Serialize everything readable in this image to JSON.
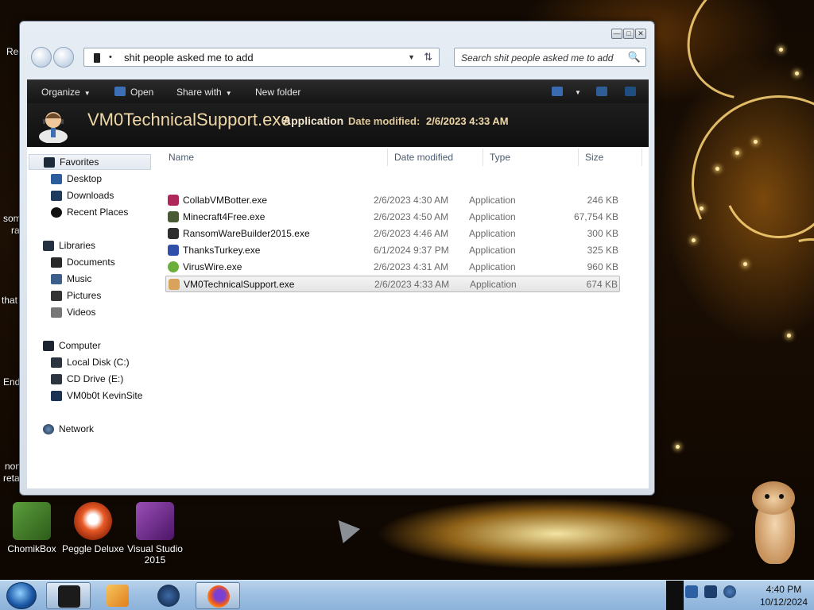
{
  "desktop": {
    "left_fragments": [
      "Rec",
      "som",
      "ra",
      "that",
      "End",
      "non",
      "reta"
    ],
    "icons": [
      {
        "label": "ChomikBox",
        "icon": "chomikbox-icon",
        "color": "#3f7d2a"
      },
      {
        "label": "Peggle Deluxe",
        "icon": "peggle-icon",
        "color": "#c43c16"
      },
      {
        "label": "Visual Studio 2015",
        "icon": "visual-studio-icon",
        "color": "#68217a"
      }
    ]
  },
  "window": {
    "caption_buttons": [
      "—",
      "□",
      "✕"
    ],
    "address": {
      "separator": "•",
      "path": "shit people asked me to add",
      "dropdown": "▼",
      "refresh": "⇅"
    },
    "search": {
      "placeholder": "Search shit people asked me to add",
      "icon": "🔍"
    },
    "toolbar": {
      "organize": "Organize",
      "open": "Open",
      "share_with": "Share with",
      "new_folder": "New folder",
      "arrow": "▼"
    },
    "details": {
      "filename": "VM0TechnicalSupport.exe",
      "type": "Application",
      "date_label": "Date modified:",
      "date_value": "2/6/2023 4:33 AM"
    },
    "nav": {
      "favorites": "Favorites",
      "favorite_items": [
        "Desktop",
        "Downloads",
        "Recent Places"
      ],
      "libraries": "Libraries",
      "library_items": [
        "Documents",
        "Music",
        "Pictures",
        "Videos"
      ],
      "computer": "Computer",
      "computer_items": [
        "Local Disk (C:)",
        "CD Drive (E:)",
        "VM0b0t KevinSite"
      ],
      "network": "Network"
    },
    "columns": {
      "name": "Name",
      "date": "Date modified",
      "type": "Type",
      "size": "Size"
    },
    "files": [
      {
        "name": "CollabVMBotter.exe",
        "date": "2/6/2023 4:30 AM",
        "type": "Application",
        "size": "246 KB",
        "color": "#b0285a"
      },
      {
        "name": "Minecraft4Free.exe",
        "date": "2/6/2023 4:50 AM",
        "type": "Application",
        "size": "67,754 KB",
        "color": "#4a5a34"
      },
      {
        "name": "RansomWareBuilder2015.exe",
        "date": "2/6/2023 4:46 AM",
        "type": "Application",
        "size": "300 KB",
        "color": "#2e2e2e"
      },
      {
        "name": "ThanksTurkey.exe",
        "date": "6/1/2024 9:37 PM",
        "type": "Application",
        "size": "325 KB",
        "color": "#2f4fa8"
      },
      {
        "name": "VirusWire.exe",
        "date": "2/6/2023 4:31 AM",
        "type": "Application",
        "size": "960 KB",
        "color": "#6cae3c"
      },
      {
        "name": "VM0TechnicalSupport.exe",
        "date": "2/6/2023 4:33 AM",
        "type": "Application",
        "size": "674 KB",
        "color": "#d9a35c"
      }
    ]
  },
  "taskbar": {
    "buttons": [
      {
        "icon": "explorer-window-icon",
        "color": "#1b1b1b"
      },
      {
        "icon": "media-player-icon",
        "color": "#e39c2a"
      },
      {
        "icon": "globe-icon",
        "color": "#1d3b66"
      },
      {
        "icon": "firefox-icon",
        "color": "#e25c1f"
      }
    ],
    "clock": {
      "time": "4:40 PM",
      "date": "10/12/2024"
    }
  }
}
